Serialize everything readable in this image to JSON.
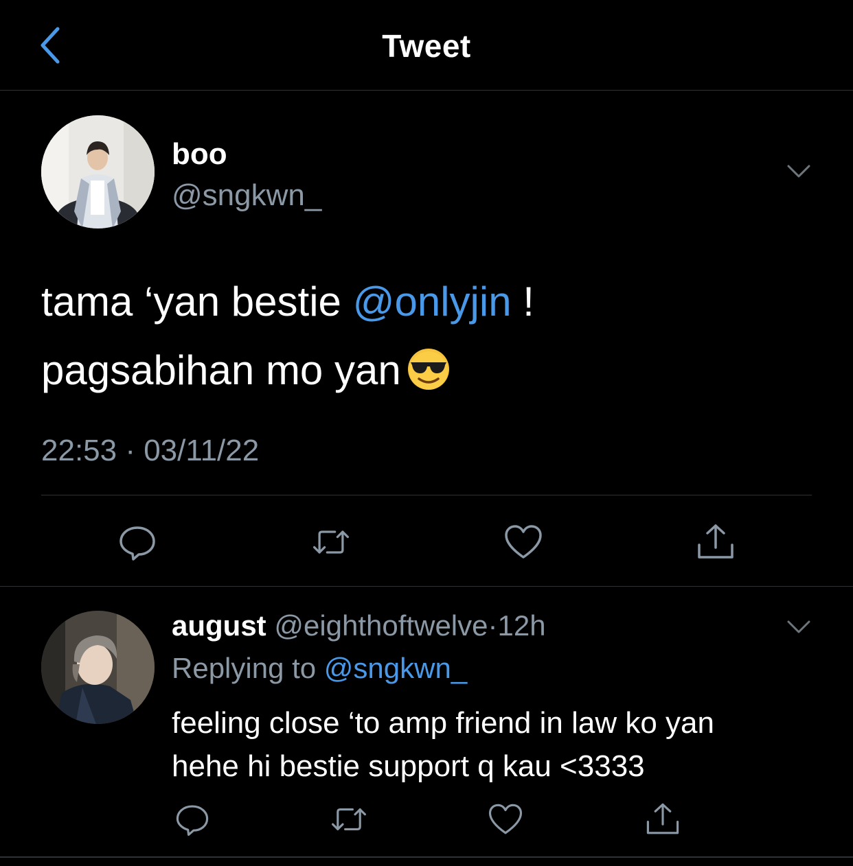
{
  "header": {
    "title": "Tweet",
    "back_icon": "chevron-left-icon"
  },
  "colors": {
    "background": "#000000",
    "accent": "#4a99e9",
    "secondary_text": "#8b98a5",
    "divider": "#2f3336"
  },
  "main_tweet": {
    "display_name": "boo",
    "handle": "@sngkwn_",
    "body_part1": "tama ‘yan bestie ",
    "mention": "@onlyjin",
    "body_part2": " !",
    "body_line2": "pagsabihan mo yan",
    "emoji": "smiling-face-with-sunglasses",
    "timestamp": "22:53 · 03/11/22",
    "actions": [
      "reply-icon",
      "retweet-icon",
      "like-icon",
      "share-icon"
    ]
  },
  "reply_tweet": {
    "display_name": "august",
    "handle": "@eighthoftwelve",
    "separator": "·",
    "time_ago": "12h",
    "replying_to_label": "Replying to ",
    "replying_to_handle": "@sngkwn_",
    "body_line1": "feeling close ‘to amp friend in law ko yan",
    "body_line2": "hehe hi bestie support q kau <3333",
    "actions": [
      "reply-icon",
      "retweet-icon",
      "like-icon",
      "share-icon"
    ]
  }
}
